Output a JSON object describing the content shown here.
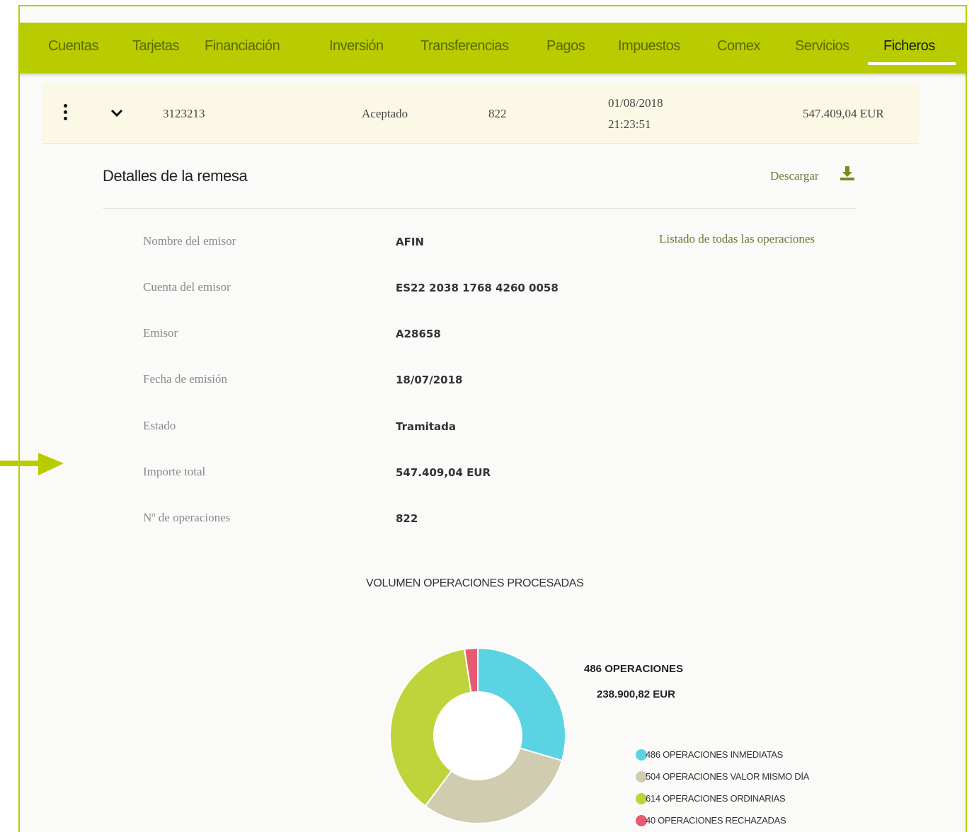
{
  "nav": {
    "items": [
      "Cuentas",
      "Tarjetas",
      "Financiación",
      "Inversión",
      "Transferencias",
      "Pagos",
      "Impuestos",
      "Comex",
      "Servicios",
      "Ficheros"
    ],
    "active": "Ficheros"
  },
  "row": {
    "id": "3123213",
    "status": "Aceptado",
    "count": "822",
    "date": "01/08/2018",
    "time": "21:23:51",
    "amount": "547.409,04 EUR"
  },
  "details": {
    "title": "Detalles de la remesa",
    "download_label": "Descargar",
    "list_link": "Listado de todas las operaciones",
    "fields": [
      {
        "label": "Nombre del emisor",
        "value": "AFIN"
      },
      {
        "label": "Cuenta del emisor",
        "value": "ES22 2038 1768 4260 0058"
      },
      {
        "label": "Emisor",
        "value": "A28658"
      },
      {
        "label": "Fecha de emisión",
        "value": "18/07/2018"
      },
      {
        "label": "Estado",
        "value": "Tramitada"
      },
      {
        "label": "Importe total",
        "value": "547.409,04 EUR"
      },
      {
        "label": "Nº de operaciones",
        "value": "822"
      }
    ]
  },
  "chart": {
    "title": "VOLUMEN OPERACIONES PROCESADAS",
    "highlight_ops": "486 OPERACIONES",
    "highlight_eur": "238.900,82 EUR",
    "legend": [
      "486 OPERACIONES INMEDIATAS",
      "504 OPERACIONES VALOR MISMO DÍA",
      "614 OPERACIONES ORDINARIAS",
      "40 OPERACIONES RECHAZADAS"
    ]
  },
  "colors": {
    "brand": "#b9cc00",
    "inmediatas": "#5bd3e3",
    "valor_mismo_dia": "#cfccb0",
    "ordinarias": "#bfd43a",
    "rechazadas": "#e85a72"
  },
  "chart_data": {
    "type": "pie",
    "title": "VOLUMEN OPERACIONES PROCESADAS",
    "categories": [
      "486 OPERACIONES INMEDIATAS",
      "504 OPERACIONES VALOR MISMO DÍA",
      "614 OPERACIONES ORDINARIAS",
      "40 OPERACIONES RECHAZADAS"
    ],
    "values": [
      486,
      504,
      614,
      40
    ],
    "legend": "right"
  }
}
